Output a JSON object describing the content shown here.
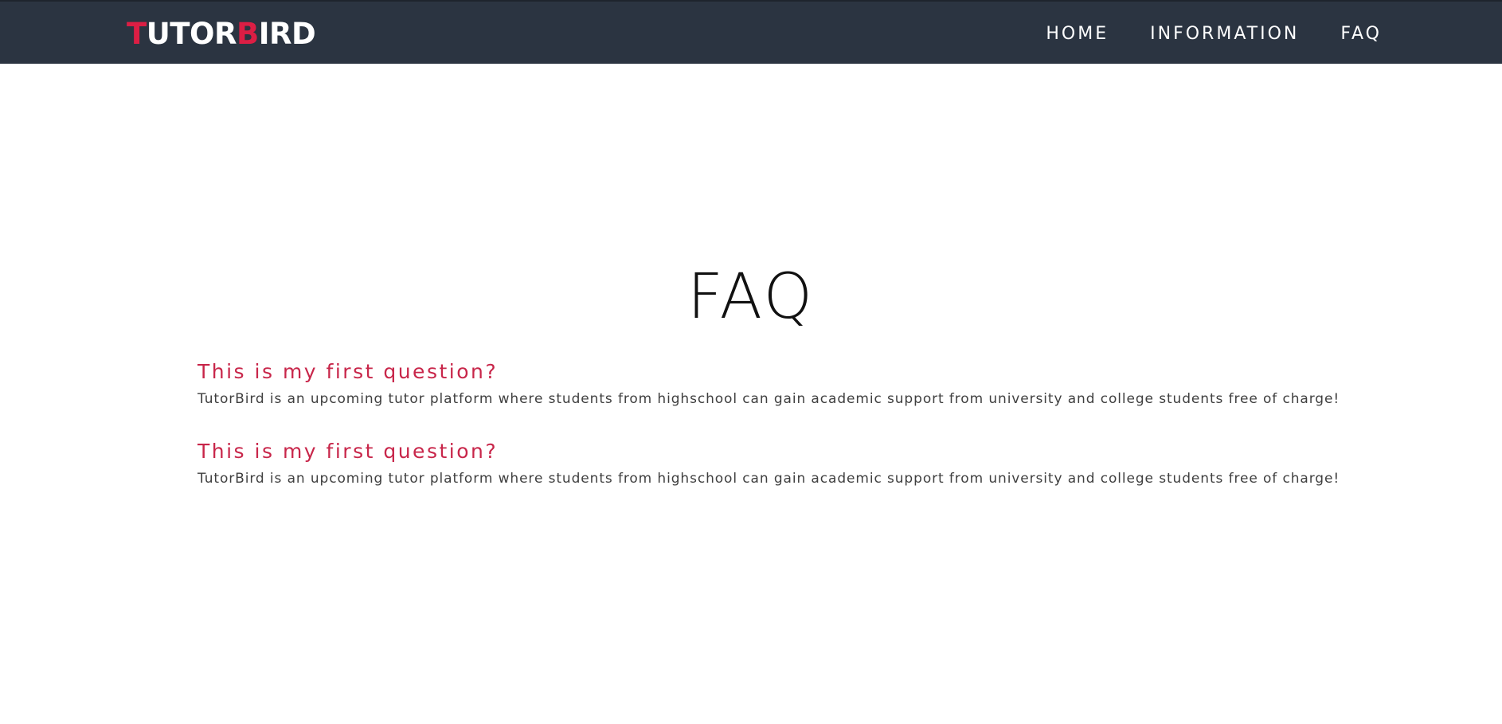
{
  "header": {
    "logo": {
      "parts": [
        {
          "text": "T",
          "accent": true
        },
        {
          "text": "UTOR",
          "accent": false
        },
        {
          "text": "B",
          "accent": true
        },
        {
          "text": "IRD",
          "accent": false
        }
      ]
    },
    "nav": [
      {
        "label": "HOME"
      },
      {
        "label": "INFORMATION"
      },
      {
        "label": "FAQ"
      }
    ]
  },
  "main": {
    "title": "FAQ",
    "faqs": [
      {
        "question": "This is my first question?",
        "answer": "TutorBird is an upcoming tutor platform where students from highschool can gain academic support from university and college students free of charge!"
      },
      {
        "question": "This is my first question?",
        "answer": "TutorBird is an upcoming tutor platform where students from highschool can gain academic support from university and college students free of charge!"
      }
    ]
  },
  "colors": {
    "navbar_bg": "#2b3441",
    "accent": "#dc1e44",
    "question": "#c8264a",
    "answer_text": "#3f3f3f",
    "nav_text": "#ffffff"
  }
}
